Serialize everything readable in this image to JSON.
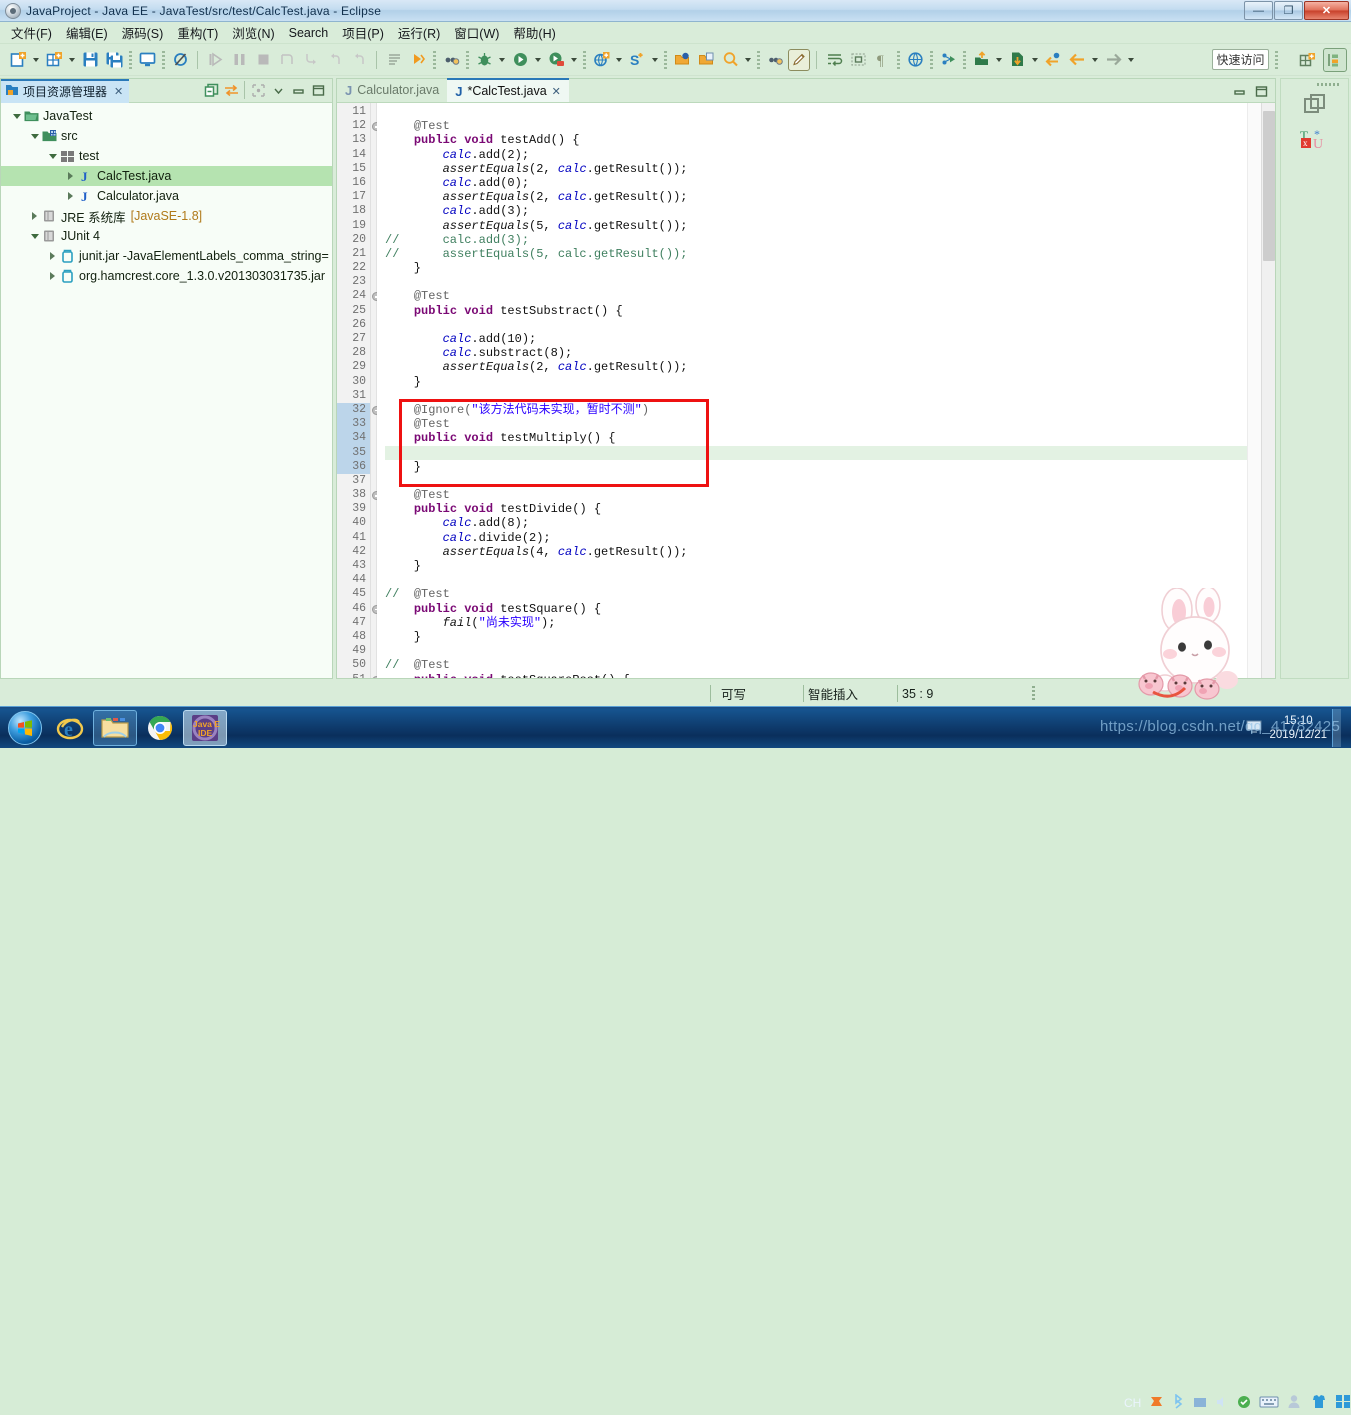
{
  "window": {
    "title": "JavaProject  -  Java EE  -  JavaTest/src/test/CalcTest.java  -  Eclipse",
    "app_icon": "eclipse-icon",
    "minimize": "—",
    "maximize": "❐",
    "close": "✕"
  },
  "menubar": {
    "items": [
      {
        "label": "文件(F)",
        "name": "menu-file"
      },
      {
        "label": "编辑(E)",
        "name": "menu-edit"
      },
      {
        "label": "源码(S)",
        "name": "menu-source"
      },
      {
        "label": "重构(T)",
        "name": "menu-refactor"
      },
      {
        "label": "浏览(N)",
        "name": "menu-navigate"
      },
      {
        "label": "Search",
        "name": "menu-search"
      },
      {
        "label": "项目(P)",
        "name": "menu-project"
      },
      {
        "label": "运行(R)",
        "name": "menu-run"
      },
      {
        "label": "窗口(W)",
        "name": "menu-window"
      },
      {
        "label": "帮助(H)",
        "name": "menu-help"
      }
    ]
  },
  "toolbar": {
    "quick_access_placeholder": "快速访问",
    "quick_access_value": "快速访问"
  },
  "explorer": {
    "tab_label": "项目资源管理器",
    "tab_close": "✕",
    "tree": [
      {
        "label": "JavaTest",
        "sub": "",
        "indent": 0,
        "arrow": "expanded",
        "icon": "project-icon",
        "selected": false
      },
      {
        "label": "src",
        "sub": "",
        "indent": 1,
        "arrow": "expanded",
        "icon": "source-folder-icon",
        "selected": false
      },
      {
        "label": "test",
        "sub": "",
        "indent": 2,
        "arrow": "expanded",
        "icon": "package-icon",
        "selected": false
      },
      {
        "label": "CalcTest.java",
        "sub": "",
        "indent": 3,
        "arrow": "collapsed",
        "icon": "java-file-icon",
        "selected": true
      },
      {
        "label": "Calculator.java",
        "sub": "",
        "indent": 3,
        "arrow": "collapsed",
        "icon": "java-file-icon",
        "selected": false
      },
      {
        "label": "JRE 系统库",
        "sub": "[JavaSE-1.8]",
        "indent": 1,
        "arrow": "collapsed",
        "icon": "library-icon",
        "selected": false
      },
      {
        "label": "JUnit 4",
        "sub": "",
        "indent": 1,
        "arrow": "expanded",
        "icon": "library-icon",
        "selected": false
      },
      {
        "label": "junit.jar -JavaElementLabels_comma_string=",
        "sub": "",
        "indent": 2,
        "arrow": "collapsed",
        "icon": "jar-icon",
        "selected": false
      },
      {
        "label": "org.hamcrest.core_1.3.0.v201303031735.jar",
        "sub": "",
        "indent": 2,
        "arrow": "collapsed",
        "icon": "jar-icon",
        "selected": false
      }
    ]
  },
  "editor": {
    "tabs": [
      {
        "label": "Calculator.java",
        "active": false,
        "dirty": false,
        "close": ""
      },
      {
        "label": "*CalcTest.java",
        "active": true,
        "dirty": true,
        "close": "✕"
      }
    ],
    "first_line": 11,
    "highlight_line": 35,
    "marked_lines": [
      32,
      33,
      34,
      35,
      36
    ],
    "fold_lines": [
      12,
      24,
      32,
      38,
      46,
      51
    ],
    "lines": [
      {
        "n": 11,
        "tokens": []
      },
      {
        "n": 12,
        "tokens": [
          {
            "t": "    ",
            "c": ""
          },
          {
            "t": "@Test",
            "c": "ann"
          }
        ]
      },
      {
        "n": 13,
        "tokens": [
          {
            "t": "    ",
            "c": ""
          },
          {
            "t": "public void ",
            "c": "kw"
          },
          {
            "t": "testAdd() {",
            "c": ""
          }
        ]
      },
      {
        "n": 14,
        "tokens": [
          {
            "t": "        ",
            "c": ""
          },
          {
            "t": "calc",
            "c": "fld"
          },
          {
            "t": ".add(2);",
            "c": ""
          }
        ]
      },
      {
        "n": 15,
        "tokens": [
          {
            "t": "        ",
            "c": ""
          },
          {
            "t": "assertEquals",
            "c": "mth"
          },
          {
            "t": "(2, ",
            "c": ""
          },
          {
            "t": "calc",
            "c": "fld"
          },
          {
            "t": ".getResult());",
            "c": ""
          }
        ]
      },
      {
        "n": 16,
        "tokens": [
          {
            "t": "        ",
            "c": ""
          },
          {
            "t": "calc",
            "c": "fld"
          },
          {
            "t": ".add(0);",
            "c": ""
          }
        ]
      },
      {
        "n": 17,
        "tokens": [
          {
            "t": "        ",
            "c": ""
          },
          {
            "t": "assertEquals",
            "c": "mth"
          },
          {
            "t": "(2, ",
            "c": ""
          },
          {
            "t": "calc",
            "c": "fld"
          },
          {
            "t": ".getResult());",
            "c": ""
          }
        ]
      },
      {
        "n": 18,
        "tokens": [
          {
            "t": "        ",
            "c": ""
          },
          {
            "t": "calc",
            "c": "fld"
          },
          {
            "t": ".add(3);",
            "c": ""
          }
        ]
      },
      {
        "n": 19,
        "tokens": [
          {
            "t": "        ",
            "c": ""
          },
          {
            "t": "assertEquals",
            "c": "mth"
          },
          {
            "t": "(5, ",
            "c": ""
          },
          {
            "t": "calc",
            "c": "fld"
          },
          {
            "t": ".getResult());",
            "c": ""
          }
        ]
      },
      {
        "n": 20,
        "tokens": [
          {
            "t": "//      calc.add(3);",
            "c": "cmt"
          }
        ]
      },
      {
        "n": 21,
        "tokens": [
          {
            "t": "//      assertEquals(5, calc.getResult());",
            "c": "cmt"
          }
        ]
      },
      {
        "n": 22,
        "tokens": [
          {
            "t": "    }",
            "c": ""
          }
        ]
      },
      {
        "n": 23,
        "tokens": []
      },
      {
        "n": 24,
        "tokens": [
          {
            "t": "    ",
            "c": ""
          },
          {
            "t": "@Test",
            "c": "ann"
          }
        ]
      },
      {
        "n": 25,
        "tokens": [
          {
            "t": "    ",
            "c": ""
          },
          {
            "t": "public void ",
            "c": "kw"
          },
          {
            "t": "testSubstract() {",
            "c": ""
          }
        ]
      },
      {
        "n": 26,
        "tokens": []
      },
      {
        "n": 27,
        "tokens": [
          {
            "t": "        ",
            "c": ""
          },
          {
            "t": "calc",
            "c": "fld"
          },
          {
            "t": ".add(10);",
            "c": ""
          }
        ]
      },
      {
        "n": 28,
        "tokens": [
          {
            "t": "        ",
            "c": ""
          },
          {
            "t": "calc",
            "c": "fld"
          },
          {
            "t": ".substract(8);",
            "c": ""
          }
        ]
      },
      {
        "n": 29,
        "tokens": [
          {
            "t": "        ",
            "c": ""
          },
          {
            "t": "assertEquals",
            "c": "mth"
          },
          {
            "t": "(2, ",
            "c": ""
          },
          {
            "t": "calc",
            "c": "fld"
          },
          {
            "t": ".getResult());",
            "c": ""
          }
        ]
      },
      {
        "n": 30,
        "tokens": [
          {
            "t": "    }",
            "c": ""
          }
        ]
      },
      {
        "n": 31,
        "tokens": []
      },
      {
        "n": 32,
        "tokens": [
          {
            "t": "    ",
            "c": ""
          },
          {
            "t": "@Ignore(",
            "c": "ann"
          },
          {
            "t": "\"该方法代码未实现，暂时不测\"",
            "c": "str"
          },
          {
            "t": ")",
            "c": "ann"
          }
        ]
      },
      {
        "n": 33,
        "tokens": [
          {
            "t": "    ",
            "c": ""
          },
          {
            "t": "@Test",
            "c": "ann"
          }
        ]
      },
      {
        "n": 34,
        "tokens": [
          {
            "t": "    ",
            "c": ""
          },
          {
            "t": "public void ",
            "c": "kw"
          },
          {
            "t": "testMultiply() {",
            "c": ""
          }
        ]
      },
      {
        "n": 35,
        "tokens": []
      },
      {
        "n": 36,
        "tokens": [
          {
            "t": "    }",
            "c": ""
          }
        ]
      },
      {
        "n": 37,
        "tokens": []
      },
      {
        "n": 38,
        "tokens": [
          {
            "t": "    ",
            "c": ""
          },
          {
            "t": "@Test",
            "c": "ann"
          }
        ]
      },
      {
        "n": 39,
        "tokens": [
          {
            "t": "    ",
            "c": ""
          },
          {
            "t": "public void ",
            "c": "kw"
          },
          {
            "t": "testDivide() {",
            "c": ""
          }
        ]
      },
      {
        "n": 40,
        "tokens": [
          {
            "t": "        ",
            "c": ""
          },
          {
            "t": "calc",
            "c": "fld"
          },
          {
            "t": ".add(8);",
            "c": ""
          }
        ]
      },
      {
        "n": 41,
        "tokens": [
          {
            "t": "        ",
            "c": ""
          },
          {
            "t": "calc",
            "c": "fld"
          },
          {
            "t": ".divide(2);",
            "c": ""
          }
        ]
      },
      {
        "n": 42,
        "tokens": [
          {
            "t": "        ",
            "c": ""
          },
          {
            "t": "assertEquals",
            "c": "mth"
          },
          {
            "t": "(4, ",
            "c": ""
          },
          {
            "t": "calc",
            "c": "fld"
          },
          {
            "t": ".getResult());",
            "c": ""
          }
        ]
      },
      {
        "n": 43,
        "tokens": [
          {
            "t": "    }",
            "c": ""
          }
        ]
      },
      {
        "n": 44,
        "tokens": []
      },
      {
        "n": 45,
        "tokens": [
          {
            "t": "//  ",
            "c": "cmt"
          },
          {
            "t": "@Test",
            "c": "ann"
          }
        ]
      },
      {
        "n": 46,
        "tokens": [
          {
            "t": "    ",
            "c": ""
          },
          {
            "t": "public void ",
            "c": "kw"
          },
          {
            "t": "testSquare() {",
            "c": ""
          }
        ]
      },
      {
        "n": 47,
        "tokens": [
          {
            "t": "        ",
            "c": ""
          },
          {
            "t": "fail",
            "c": "mth"
          },
          {
            "t": "(",
            "c": ""
          },
          {
            "t": "\"尚未实现\"",
            "c": "str"
          },
          {
            "t": ");",
            "c": ""
          }
        ]
      },
      {
        "n": 48,
        "tokens": [
          {
            "t": "    }",
            "c": ""
          }
        ]
      },
      {
        "n": 49,
        "tokens": []
      },
      {
        "n": 50,
        "tokens": [
          {
            "t": "//  ",
            "c": "cmt"
          },
          {
            "t": "@Test",
            "c": "ann"
          }
        ]
      },
      {
        "n": 51,
        "tokens": [
          {
            "t": "    ",
            "c": ""
          },
          {
            "t": "public void ",
            "c": "kw"
          },
          {
            "t": "testSquareRoot() {",
            "c": ""
          }
        ]
      }
    ]
  },
  "annotation": {
    "red_box_color": "#ee1111",
    "red_box_lines": "32-37"
  },
  "statusbar": {
    "writable": "可写",
    "insert_mode": "智能插入",
    "position": "35 : 9"
  },
  "taskbar": {
    "start": "start-orb",
    "buttons": [
      {
        "name": "taskbar-ie",
        "label": "Internet Explorer"
      },
      {
        "name": "taskbar-explorer",
        "label": "Windows Explorer"
      },
      {
        "name": "taskbar-chrome",
        "label": "Google Chrome"
      },
      {
        "name": "taskbar-eclipse",
        "label": "Java EE IDE"
      }
    ],
    "clock_time": "15:10",
    "clock_date": "2019/12/21",
    "ime_label": "CH"
  },
  "watermark": {
    "text": "https://blog.csdn.net/qq_41782425"
  }
}
